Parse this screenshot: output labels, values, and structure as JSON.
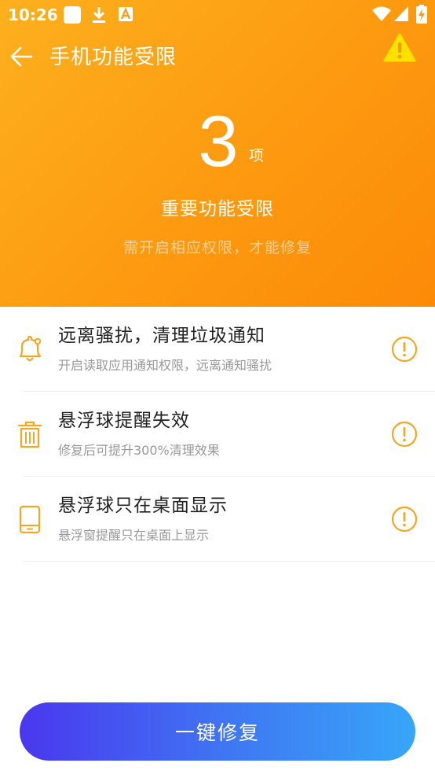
{
  "status_bar": {
    "time": "10:26",
    "left_icons": [
      "app-square-icon",
      "download-icon",
      "keyboard-a-icon"
    ],
    "right_icons": [
      "wifi-icon",
      "signal-icon",
      "battery-charging-icon"
    ]
  },
  "header": {
    "title": "手机功能受限",
    "count": "3",
    "count_unit": "项",
    "subtitle": "重要功能受限",
    "hint": "需开启相应权限，才能修复"
  },
  "items": [
    {
      "icon": "bell-icon",
      "title": "远离骚扰，清理垃圾通知",
      "desc": "开启读取应用通知权限，远离通知骚扰"
    },
    {
      "icon": "trash-icon",
      "title": "悬浮球提醒失效",
      "desc": "修复后可提升300%清理效果"
    },
    {
      "icon": "tablet-icon",
      "title": "悬浮球只在桌面显示",
      "desc": "悬浮窗提醒只在桌面上显示"
    }
  ],
  "button": {
    "label": "一键修复"
  },
  "colors": {
    "header_start": "#fdb01e",
    "header_end": "#fc8a08",
    "accent_orange": "#f5a623",
    "button_start": "#4a37ee",
    "button_end": "#37a6f8",
    "warning_yellow": "#ffe100"
  }
}
